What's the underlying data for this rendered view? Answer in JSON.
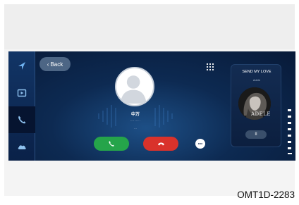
{
  "sidebar": {
    "items": [
      {
        "name": "navigation",
        "icon": "navigation-arrow-icon"
      },
      {
        "name": "media",
        "icon": "media-player-icon"
      },
      {
        "name": "phone",
        "icon": "phone-icon",
        "active": true
      },
      {
        "name": "connected-services",
        "icon": "cloud-icon"
      }
    ]
  },
  "header": {
    "back_chevron": "‹",
    "back_label": "Back",
    "keypad_icon": "keypad-icon"
  },
  "call": {
    "caller_name": "中万",
    "caller_number": "···· ···· ·",
    "call_status": "···",
    "accept_icon": "phone-accept-icon",
    "decline_icon": "phone-decline-icon",
    "message_icon": "message-icon"
  },
  "media": {
    "song_title": "SEND MY LOVE",
    "artist": "Adele",
    "album_text": "ADELE",
    "pause_label": "II"
  },
  "footer": {
    "image_code": "OMT1D-2283"
  },
  "colors": {
    "screen_dark": "#081a38",
    "screen_glow": "#1d4f86",
    "accept_green": "#25a44a",
    "decline_red": "#d9322b"
  }
}
